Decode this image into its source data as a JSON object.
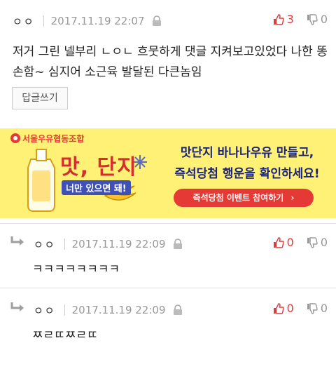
{
  "comments": [
    {
      "author": "ㅇㅇ",
      "date": "2017.11.19 22:07",
      "up": "3",
      "down": "0",
      "text": "저거 그린 넬부리 ㄴㅇㄴ 흐뭇하게 댓글 지켜보고있었다 나한 똥손함~ 심지어 소근육 발달된 다큰놈임",
      "reply_label": "답글쓰기"
    },
    {
      "author": "ㅇㅇ",
      "date": "2017.11.19 22:09",
      "up": "0",
      "down": "0",
      "text": "ㅋㅋㅋㅋㅋㅋㅋㅋ"
    },
    {
      "author": "ㅇㅇ",
      "date": "2017.11.19 22:09",
      "up": "0",
      "down": "0",
      "text": "ㅉㄹㄸㅉㄹㄸ"
    }
  ],
  "ad": {
    "brand": "서울우유협동조합",
    "logo_text": "맛, 단지",
    "logo_sub": "너만 있으면 돼!",
    "headline_1": "맛단지 바나나우유 만들고,",
    "headline_2": "즉석당첨 행운을 확인하세요!",
    "cta": "즉석당첨 이벤트 참여하기",
    "cta_arrow": "›",
    "colors": {
      "bg": "#fff176",
      "cta_bg": "#e53935",
      "brand_red": "#e53935"
    }
  },
  "icons": [
    "lock-icon",
    "thumbs-up-icon",
    "thumbs-down-icon",
    "reply-arrow-icon"
  ],
  "colors": {
    "upvote": "#e03a3a",
    "muted": "#999999",
    "divider": "#e2e2e2"
  }
}
